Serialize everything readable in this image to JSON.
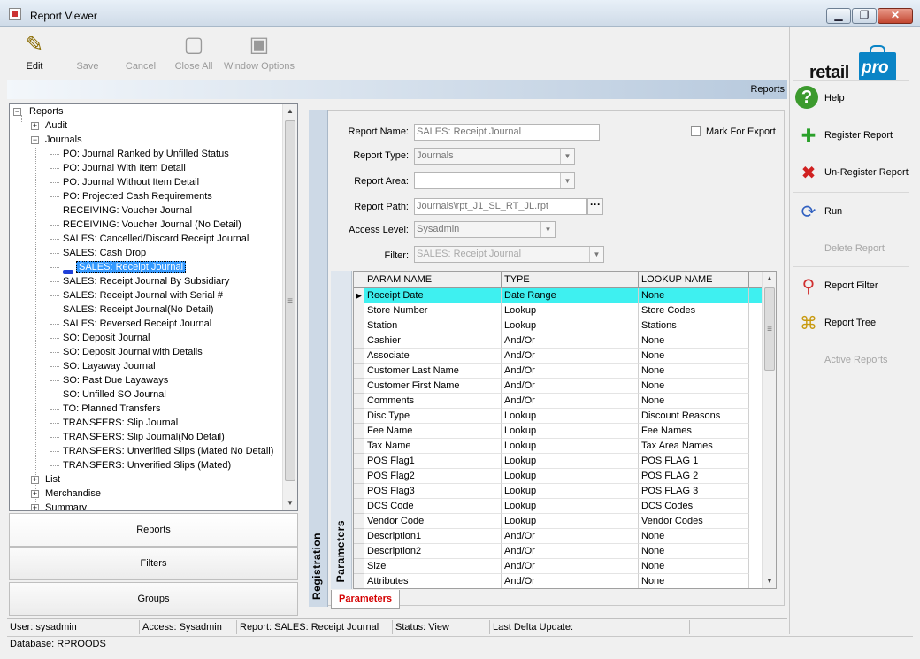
{
  "window": {
    "title": "Report Viewer",
    "min": "▁",
    "max": "❐",
    "close": "✕"
  },
  "toolbar": [
    {
      "label": "Edit",
      "icon": "✎",
      "enabled": true
    },
    {
      "label": "Save",
      "icon": "",
      "enabled": false
    },
    {
      "label": "Cancel",
      "icon": "",
      "enabled": false
    },
    {
      "label": "Close All",
      "icon": "▢",
      "enabled": false
    },
    {
      "label": "Window Options",
      "icon": "▣",
      "enabled": false
    }
  ],
  "header": {
    "title": "Reports"
  },
  "logo": {
    "word": "retail",
    "bag": "pro"
  },
  "side_actions": [
    {
      "label": "Help",
      "icon": "?",
      "enabled": true,
      "color": "#3c9a2e"
    },
    {
      "label": "Register Report",
      "icon": "✚",
      "enabled": true,
      "color": "#2aa02a"
    },
    {
      "label": "Un-Register Report",
      "icon": "✖",
      "enabled": true,
      "color": "#d02020"
    },
    {
      "label": "Run",
      "icon": "⟳",
      "enabled": true,
      "color": "#3060c0"
    },
    {
      "label": "Delete Report",
      "icon": "",
      "enabled": false,
      "color": "#999999"
    },
    {
      "label": "Report Filter",
      "icon": "⚲",
      "enabled": true,
      "color": "#d03030"
    },
    {
      "label": "Report Tree",
      "icon": "⌘",
      "enabled": true,
      "color": "#c89a10"
    },
    {
      "label": "Active Reports",
      "icon": "",
      "enabled": false,
      "color": "#999999"
    }
  ],
  "tree": {
    "root": "Reports",
    "groups": [
      "Audit",
      "Journals"
    ],
    "journals": [
      "PO: Journal Ranked by Unfilled Status",
      "PO: Journal With Item Detail",
      "PO: Journal Without Item Detail",
      "PO: Projected Cash Requirements",
      "RECEIVING: Voucher Journal",
      "RECEIVING: Voucher Journal (No Detail)",
      "SALES: Cancelled/Discard Receipt Journal",
      "SALES: Cash Drop",
      "SALES: Receipt Journal",
      "SALES: Receipt Journal By Subsidiary",
      "SALES: Receipt Journal with Serial #",
      "SALES: Receipt Journal(No Detail)",
      "SALES: Reversed Receipt Journal",
      "SO: Deposit Journal",
      "SO: Deposit Journal with Details",
      "SO: Layaway Journal",
      "SO: Past Due Layaways",
      "SO: Unfilled SO Journal",
      "TO: Planned Transfers",
      "TRANSFERS: Slip Journal",
      "TRANSFERS: Slip Journal(No Detail)",
      "TRANSFERS: Unverified Slips (Mated No Detail)",
      "TRANSFERS: Unverified Slips (Mated)"
    ],
    "selected_index": 8,
    "after_groups": [
      "List",
      "Merchandise",
      "Summary"
    ]
  },
  "nav": [
    "Reports",
    "Filters",
    "Groups"
  ],
  "form": {
    "report_name_label": "Report Name:",
    "report_name": "SALES: Receipt Journal",
    "mark_export_label": "Mark For Export",
    "report_type_label": "Report Type:",
    "report_type": "Journals",
    "report_area_label": "Report Area:",
    "report_area": "",
    "report_path_label": "Report Path:",
    "report_path": "Journals\\rpt_J1_SL_RT_JL.rpt",
    "ellipsis": "···",
    "access_level_label": "Access Level:",
    "access_level": "Sysadmin",
    "filter_label": "Filter:",
    "filter": "SALES: Receipt Journal"
  },
  "grid": {
    "columns": [
      "PARAM NAME",
      "TYPE",
      "LOOKUP NAME"
    ],
    "rows": [
      [
        "Receipt Date",
        "Date Range",
        "None"
      ],
      [
        "Store Number",
        "Lookup",
        "Store Codes"
      ],
      [
        "Station",
        "Lookup",
        "Stations"
      ],
      [
        "Cashier",
        "And/Or",
        "None"
      ],
      [
        "Associate",
        "And/Or",
        "None"
      ],
      [
        "Customer Last Name",
        "And/Or",
        "None"
      ],
      [
        "Customer First Name",
        "And/Or",
        "None"
      ],
      [
        "Comments",
        "And/Or",
        "None"
      ],
      [
        "Disc Type",
        "Lookup",
        "Discount Reasons"
      ],
      [
        "Fee Name",
        "Lookup",
        "Fee Names"
      ],
      [
        "Tax Name",
        "Lookup",
        "Tax Area Names"
      ],
      [
        "POS Flag1",
        "Lookup",
        "POS FLAG 1"
      ],
      [
        "POS Flag2",
        "Lookup",
        "POS FLAG 2"
      ],
      [
        "POS Flag3",
        "Lookup",
        "POS FLAG 3"
      ],
      [
        "DCS Code",
        "Lookup",
        "DCS Codes"
      ],
      [
        "Vendor Code",
        "Lookup",
        "Vendor Codes"
      ],
      [
        "Description1",
        "And/Or",
        "None"
      ],
      [
        "Description2",
        "And/Or",
        "None"
      ],
      [
        "Size",
        "And/Or",
        "None"
      ],
      [
        "Attributes",
        "And/Or",
        "None"
      ]
    ],
    "selected_row": 0,
    "row_pointer": "▶"
  },
  "tabs": {
    "registration": "Registration",
    "parameters": "Parameters",
    "bottom": "Parameters"
  },
  "status": {
    "user": "User: sysadmin",
    "access": "Access: Sysadmin",
    "report": "Report: SALES: Receipt Journal",
    "status": "Status: View",
    "delta": "Last Delta Update:",
    "database": "Database: RPROODS"
  },
  "scroll": {
    "up": "▲",
    "down": "▼",
    "grip": "≡"
  }
}
